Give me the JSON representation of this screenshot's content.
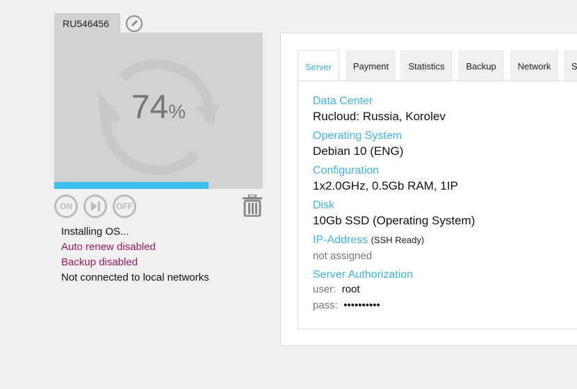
{
  "server": {
    "id": "RU546456",
    "progress_percent": 74,
    "progress_text": "74",
    "percent_sign": "%"
  },
  "controls": {
    "on": "ON",
    "off": "OFF"
  },
  "status": {
    "line1": "Installing OS...",
    "line2": "Auto renew disabled",
    "line3": "Backup disabled",
    "line4": "Not connected to local networks"
  },
  "colors": {
    "accent": "#3cb4ec",
    "progress": "#3cc0ef",
    "warning": "#a0185a"
  },
  "tabs": [
    "Server",
    "Payment",
    "Statistics",
    "Backup",
    "Network",
    "S"
  ],
  "details": {
    "dc_label": "Data Center",
    "dc_value": "Rucloud: Russia, Korolev",
    "os_label": "Operating System",
    "os_value": "Debian 10 (ENG)",
    "cfg_label": "Configuration",
    "cfg_value": "1x2.0GHz, 0.5Gb RAM, 1IP",
    "disk_label": "Disk",
    "disk_value": "10Gb SSD (Operating System)",
    "ip_label": "IP-Address",
    "ip_note": "(SSH Ready)",
    "ip_value": "not assigned",
    "auth_label": "Server Authorization",
    "user_label": "user:",
    "user_value": "root",
    "pass_label": "pass:",
    "pass_value": "••••••••••"
  }
}
